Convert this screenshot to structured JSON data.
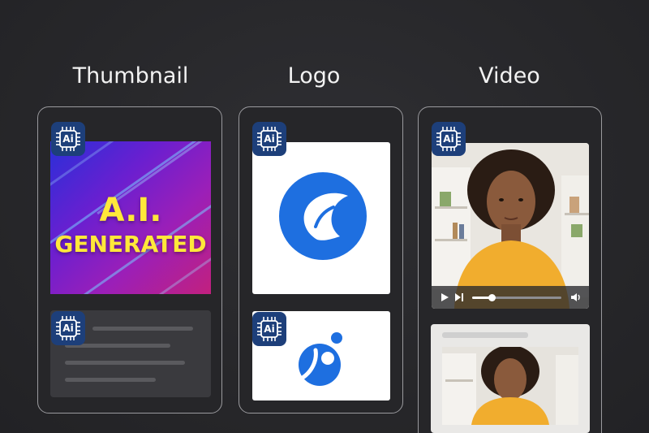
{
  "columns": [
    {
      "title": "Thumbnail"
    },
    {
      "title": "Logo"
    },
    {
      "title": "Video"
    }
  ],
  "badge": {
    "label": "Ai",
    "icon": "ai-chip-icon"
  },
  "thumbnail": {
    "line1": "A.I.",
    "line2": "GENERATED"
  },
  "colors": {
    "accent": "#1e6fe0",
    "badge_bg": "#1d3f7a",
    "thumb_text": "#ffe83a"
  },
  "video": {
    "progress": 0.22
  }
}
